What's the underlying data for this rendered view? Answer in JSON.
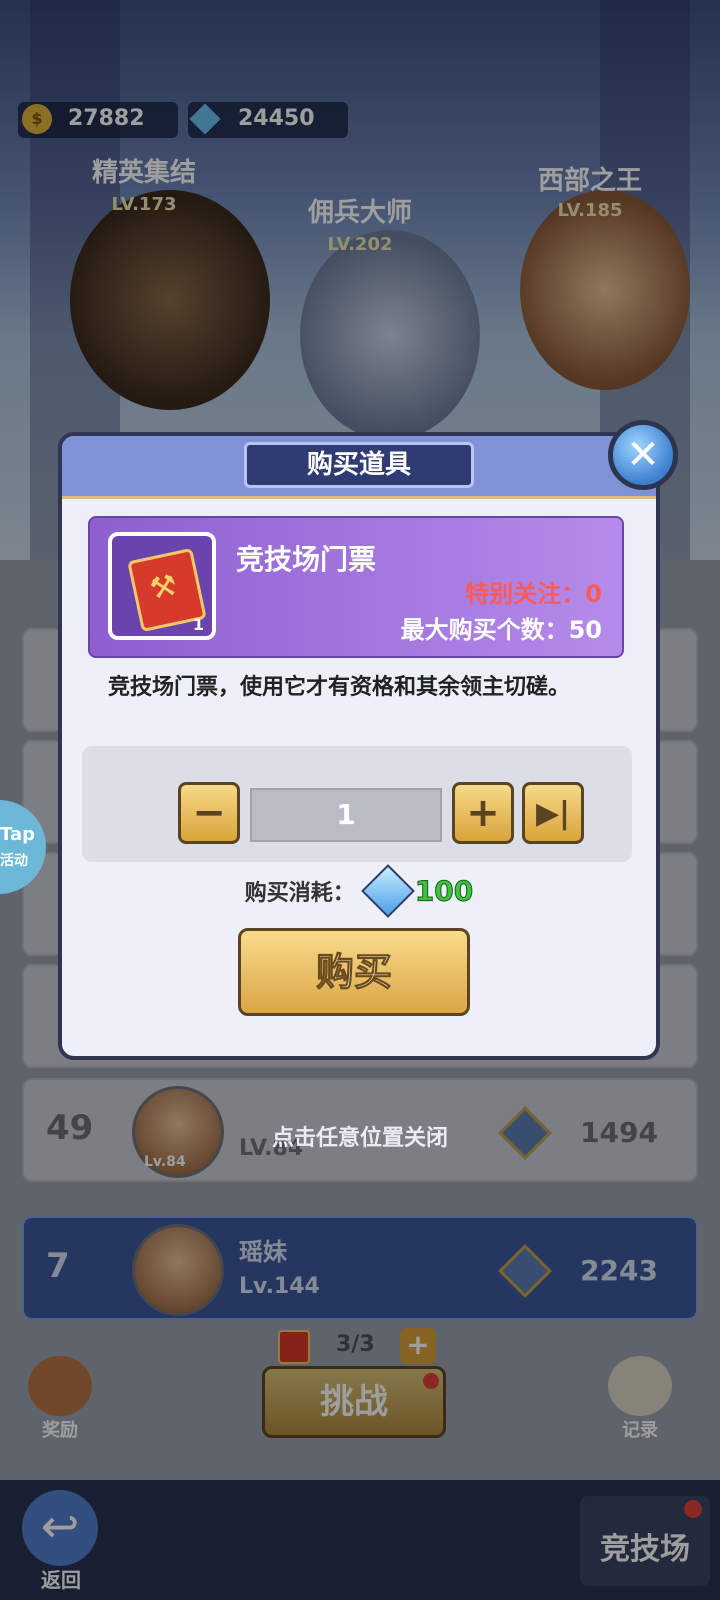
{
  "currency": {
    "gold": "27882",
    "diamonds": "24450"
  },
  "heroes": [
    {
      "title": "精英集结",
      "level": "LV.173"
    },
    {
      "title": "佣兵大师",
      "level": "LV.202"
    },
    {
      "title": "西部之王",
      "level": "LV.185"
    }
  ],
  "side_tab": {
    "label1": "Tap",
    "label2": "活动"
  },
  "rows": [
    {
      "rank": "49",
      "name": "",
      "level": "LV.84",
      "avatar_level": "Lv.84",
      "score": "1494"
    }
  ],
  "my_row": {
    "rank": "7",
    "name": "瑶妹",
    "level": "Lv.144",
    "score": "2243"
  },
  "tickets": "3/3",
  "buttons": {
    "reward": "奖励",
    "challenge": "挑战",
    "records": "记录",
    "back": "返回",
    "arena": "竞技场"
  },
  "dialog": {
    "title": "购买道具",
    "item_name": "竞技场门票",
    "item_qty": "1",
    "special_attention": "特别关注：0",
    "max_buy": "最大购买个数：50",
    "description": "竞技场门票，使用它才有资格和其余领主切磋。",
    "quantity": "1",
    "cost_label": "购买消耗：",
    "cost_value": "100",
    "buy_label": "购买",
    "close_hint": "点击任意位置关闭"
  },
  "colors": {
    "accent_purple": "#8d5fd0",
    "gold_button": "#dba646",
    "cost_green": "#3cc43c",
    "alert_red": "#ff5a5a"
  }
}
